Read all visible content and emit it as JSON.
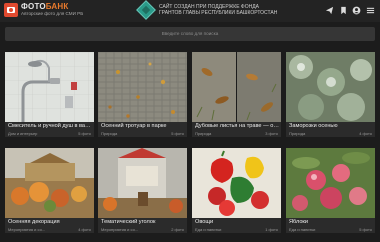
{
  "header": {
    "brand_part1": "ФОТО",
    "brand_part2": "БАНК",
    "brand_subtitle": "Авторские фото для СМИ РБ",
    "notice": "САЙТ СОЗДАН ПРИ ПОДДЕРЖКЕ ФОНДА\nГРАНТОВ ГЛАВЫ РЕСПУБЛИКИ БАШКОРТОСТАН",
    "icons": [
      "send-icon",
      "bookmark-icon",
      "user-icon",
      "menu-icon"
    ]
  },
  "search": {
    "placeholder": "Введите слово для поиска"
  },
  "albums": [
    {
      "title": "Смеситель и ручной душ в ван...",
      "category": "Дом и интерьер",
      "count": "5 фото"
    },
    {
      "title": "Осенний тротуар в парке",
      "category": "Природа",
      "count": "5 фото"
    },
    {
      "title": "Дубовые листья на траве — ос...",
      "category": "Природа",
      "count": "3 фото"
    },
    {
      "title": "Заморозки осенью",
      "category": "Природа",
      "count": "4 фото"
    },
    {
      "title": "Осенняя декорация",
      "category": "Мероприятия и со...",
      "count": "4 фото"
    },
    {
      "title": "Тематический уголок",
      "category": "Мероприятия и со...",
      "count": "2 фото"
    },
    {
      "title": "Овощи",
      "category": "Еда и напитки",
      "count": "1 фото"
    },
    {
      "title": "Яблоки",
      "category": "Еда и напитки",
      "count": "5 фото"
    }
  ]
}
